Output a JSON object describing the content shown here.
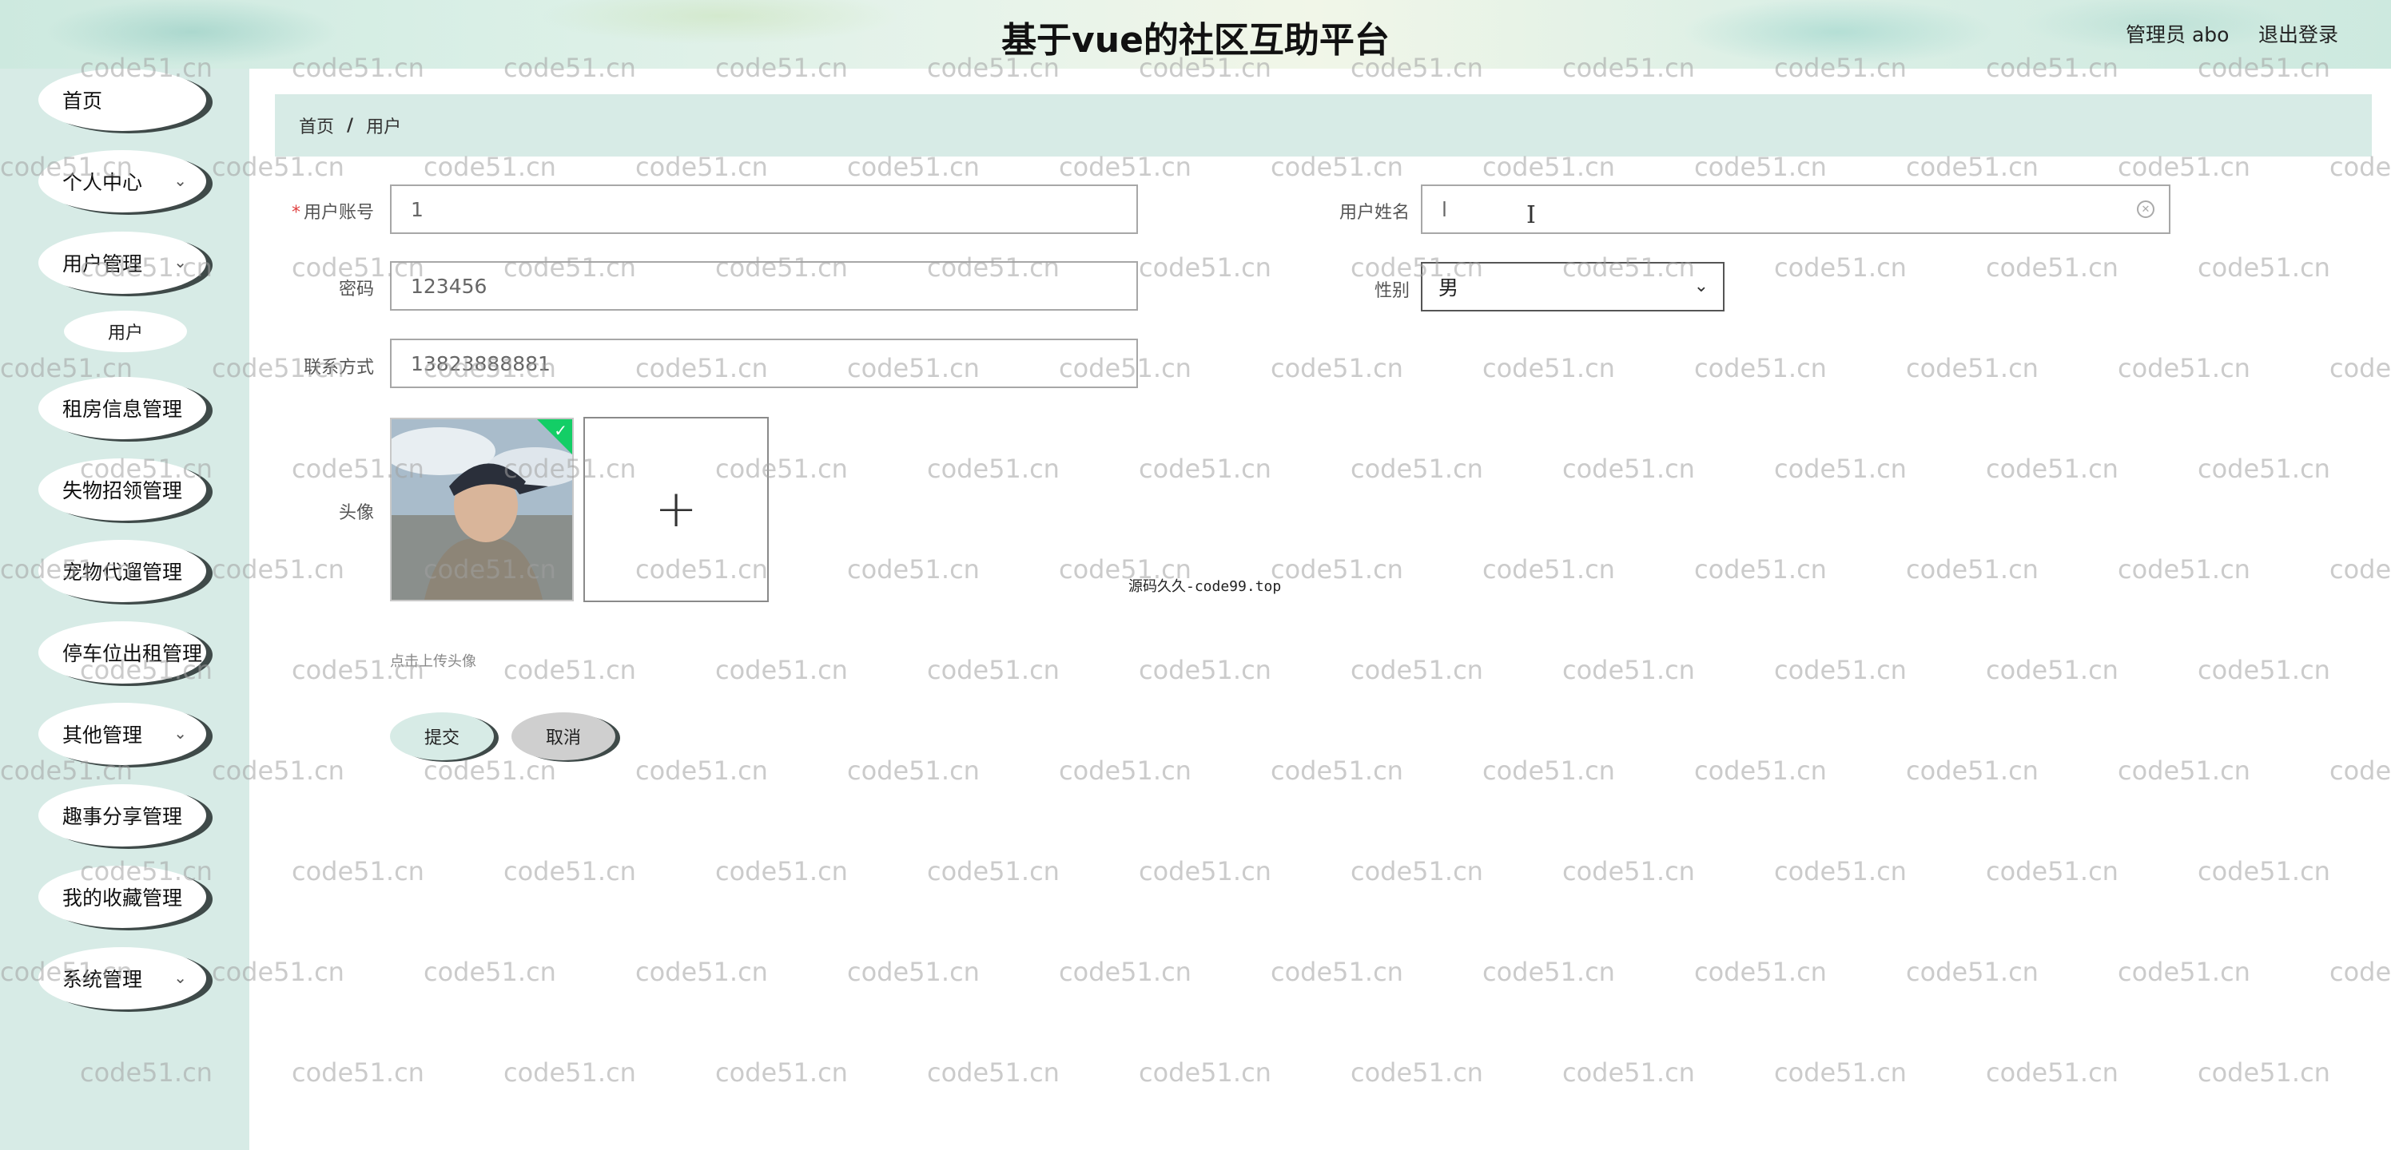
{
  "header": {
    "title": "基于vue的社区互助平台",
    "user": "管理员 abo",
    "logout": "退出登录"
  },
  "sidebar": {
    "items": [
      {
        "label": "首页",
        "has_children": false
      },
      {
        "label": "个人中心",
        "has_children": true
      },
      {
        "label": "用户管理",
        "has_children": true
      },
      {
        "label": "租房信息管理",
        "has_children": false
      },
      {
        "label": "失物招领管理",
        "has_children": false
      },
      {
        "label": "宠物代遛管理",
        "has_children": false
      },
      {
        "label": "停车位出租管理",
        "has_children": false
      },
      {
        "label": "其他管理",
        "has_children": true
      },
      {
        "label": "趣事分享管理",
        "has_children": false
      },
      {
        "label": "我的收藏管理",
        "has_children": false
      },
      {
        "label": "系统管理",
        "has_children": true
      }
    ],
    "sub_item": "用户"
  },
  "breadcrumb": {
    "home": "首页",
    "separator": "/",
    "current": "用户"
  },
  "form": {
    "account_label": "用户账号",
    "account_required": "*",
    "account_value": "1",
    "name_label": "用户姓名",
    "name_value": "l",
    "password_label": "密码",
    "password_value": "123456",
    "gender_label": "性别",
    "gender_value": "男",
    "phone_label": "联系方式",
    "phone_value": "13823888881",
    "avatar_label": "头像",
    "upload_hint": "点击上传头像",
    "submit": "提交",
    "cancel": "取消"
  },
  "source_tag": "源码久久-code99.top",
  "watermark_text": "code51.cn",
  "colors": {
    "sidebar_bg": "#d7ebe6",
    "nav_shadow": "#3f4a49",
    "upload_success": "#13ce66",
    "required": "#e04040"
  },
  "icons": {
    "expand": "chevron-down-icon",
    "clear": "circle-close-icon",
    "upload": "plus-icon",
    "text_cursor": "text-cursor-icon"
  }
}
